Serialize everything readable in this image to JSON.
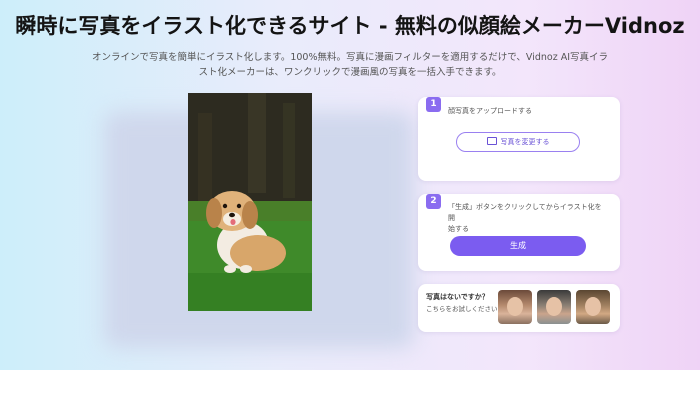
{
  "hero": {
    "title": "瞬時に写真をイラスト化できるサイト - 無料の似顔絵メーカーVidnoz",
    "subtitle_line1": "オンラインで写真を簡単にイラスト化します。100%無料。写真に漫画フィルターを適用するだけで、Vidnoz AI写真イラ",
    "subtitle_line2": "スト化メーカーは、ワンクリックで漫画風の写真を一括入手できます。"
  },
  "steps": [
    {
      "number": "1",
      "text": "顔写真をアップロードする",
      "button": "写真を変更する",
      "button_icon": "image-icon"
    },
    {
      "number": "2",
      "text_line1": "「生成」ボタンをクリックしてからイラスト化を開",
      "text_line2": "始する",
      "button": "生成"
    }
  ],
  "samples": {
    "label": "写真はないですか？",
    "sub": "こちらをお試しください"
  },
  "colors": {
    "accent": "#7b5cf0",
    "step_badge": "#8a6cf0"
  }
}
